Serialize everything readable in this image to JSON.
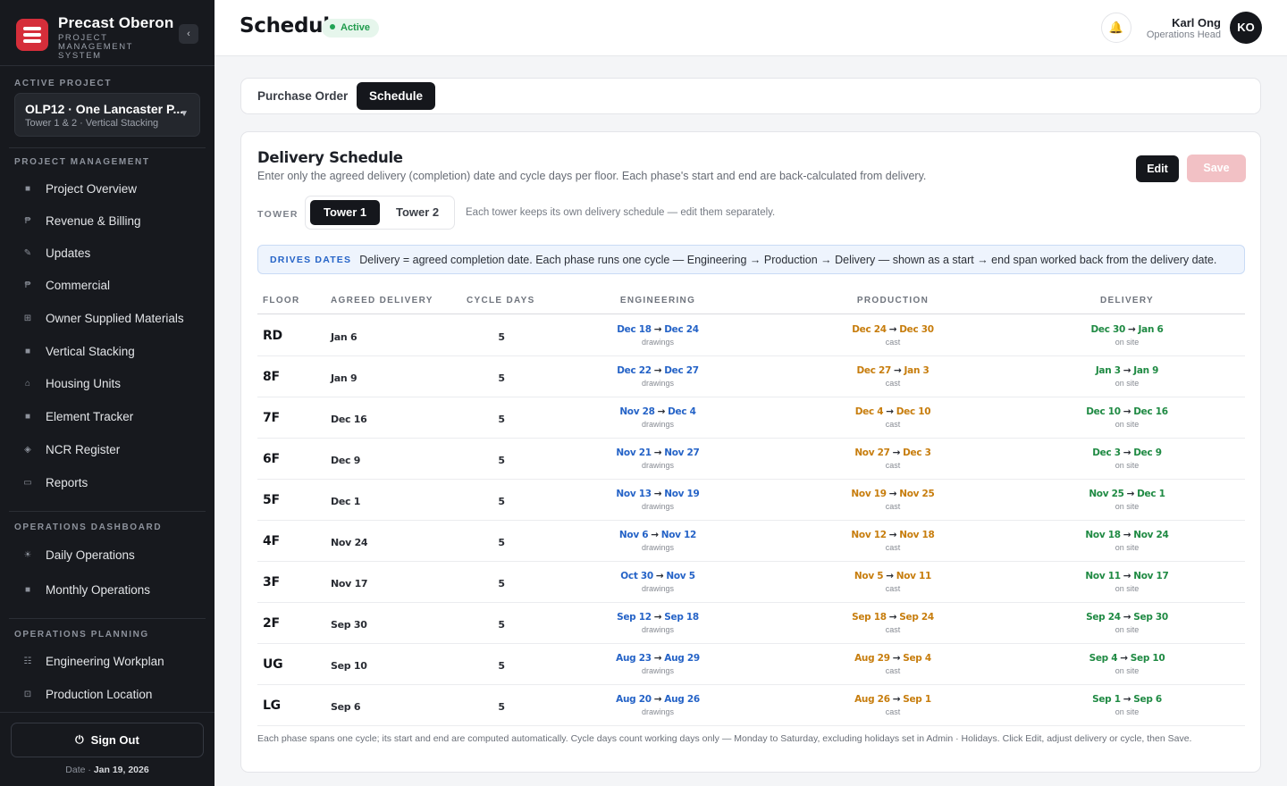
{
  "brand": {
    "name": "Precast Oberon",
    "subtitle": "PROJECT MANAGEMENT SYSTEM"
  },
  "active_project": {
    "label": "ACTIVE PROJECT",
    "name": "OLP12 · One Lancaster P...",
    "subtitle": "Tower 1 & 2 · Vertical Stacking"
  },
  "nav": {
    "project_management": {
      "label": "PROJECT MANAGEMENT",
      "items": [
        {
          "label": "Project Overview",
          "icon": "square-icon",
          "glyph": "■"
        },
        {
          "label": "Revenue & Billing",
          "icon": "peso-icon",
          "glyph": "₱"
        },
        {
          "label": "Updates",
          "icon": "pencil-icon",
          "glyph": "✎"
        },
        {
          "label": "Commercial",
          "icon": "peso-icon",
          "glyph": "₱"
        },
        {
          "label": "Owner Supplied Materials",
          "icon": "grid-icon",
          "glyph": "⊞"
        },
        {
          "label": "Vertical Stacking",
          "icon": "square-icon",
          "glyph": "■"
        },
        {
          "label": "Housing Units",
          "icon": "home-icon",
          "glyph": "⌂"
        },
        {
          "label": "Element Tracker",
          "icon": "square-icon",
          "glyph": "■"
        },
        {
          "label": "NCR Register",
          "icon": "diamond-icon",
          "glyph": "◈"
        },
        {
          "label": "Reports",
          "icon": "reports-icon",
          "glyph": "▭"
        }
      ]
    },
    "operations_dashboard": {
      "label": "OPERATIONS DASHBOARD",
      "items": [
        {
          "label": "Daily Operations",
          "icon": "sun-icon",
          "glyph": "☀"
        },
        {
          "label": "Monthly Operations",
          "icon": "square-icon",
          "glyph": "■"
        }
      ]
    },
    "operations_planning": {
      "label": "OPERATIONS PLANNING",
      "items": [
        {
          "label": "Engineering Workplan",
          "icon": "list-icon",
          "glyph": "☷"
        },
        {
          "label": "Production Location",
          "icon": "location-icon",
          "glyph": "⊡"
        }
      ]
    }
  },
  "signout": {
    "label": "Sign Out",
    "icon": "power-icon"
  },
  "footer_date": {
    "label": "Date ·",
    "value": "Jan 19, 2026"
  },
  "header": {
    "title": "Schedule",
    "status": "Active",
    "user": {
      "name": "Karl Ong",
      "role": "Operations Head",
      "initials": "KO"
    }
  },
  "tabs": [
    {
      "label": "Purchase Order",
      "active": false
    },
    {
      "label": "Schedule",
      "active": true
    }
  ],
  "schedule": {
    "title": "Delivery Schedule",
    "description": "Enter only the agreed delivery (completion) date and cycle days per floor. Each phase's start and end are back-calculated from delivery.",
    "edit_label": "Edit",
    "save_label": "Save",
    "tower_label": "TOWER",
    "towers": [
      {
        "label": "Tower 1",
        "active": true
      },
      {
        "label": "Tower 2",
        "active": false
      }
    ],
    "tower_note": "Each tower keeps its own delivery schedule — edit them separately.",
    "banner": {
      "tag": "DRIVES DATES",
      "text": "Delivery = agreed completion date. Each phase runs one cycle — Engineering → Production → Delivery — shown as a start → end span worked back from the delivery date."
    },
    "columns": [
      "FLOOR",
      "AGREED DELIVERY",
      "CYCLE DAYS",
      "ENGINEERING",
      "PRODUCTION",
      "DELIVERY"
    ],
    "phase_subs": {
      "engineering": "drawings",
      "production": "cast",
      "delivery": "on site"
    },
    "rows": [
      {
        "floor": "RD",
        "agreed": "Jan 6",
        "cycle": "5",
        "eng": [
          "Dec 18",
          "Dec 24"
        ],
        "prod": [
          "Dec 24",
          "Dec 30"
        ],
        "del": [
          "Dec 30",
          "Jan 6"
        ]
      },
      {
        "floor": "8F",
        "agreed": "Jan 9",
        "cycle": "5",
        "eng": [
          "Dec 22",
          "Dec 27"
        ],
        "prod": [
          "Dec 27",
          "Jan 3"
        ],
        "del": [
          "Jan 3",
          "Jan 9"
        ]
      },
      {
        "floor": "7F",
        "agreed": "Dec 16",
        "cycle": "5",
        "eng": [
          "Nov 28",
          "Dec 4"
        ],
        "prod": [
          "Dec 4",
          "Dec 10"
        ],
        "del": [
          "Dec 10",
          "Dec 16"
        ]
      },
      {
        "floor": "6F",
        "agreed": "Dec 9",
        "cycle": "5",
        "eng": [
          "Nov 21",
          "Nov 27"
        ],
        "prod": [
          "Nov 27",
          "Dec 3"
        ],
        "del": [
          "Dec 3",
          "Dec 9"
        ]
      },
      {
        "floor": "5F",
        "agreed": "Dec 1",
        "cycle": "5",
        "eng": [
          "Nov 13",
          "Nov 19"
        ],
        "prod": [
          "Nov 19",
          "Nov 25"
        ],
        "del": [
          "Nov 25",
          "Dec 1"
        ]
      },
      {
        "floor": "4F",
        "agreed": "Nov 24",
        "cycle": "5",
        "eng": [
          "Nov 6",
          "Nov 12"
        ],
        "prod": [
          "Nov 12",
          "Nov 18"
        ],
        "del": [
          "Nov 18",
          "Nov 24"
        ]
      },
      {
        "floor": "3F",
        "agreed": "Nov 17",
        "cycle": "5",
        "eng": [
          "Oct 30",
          "Nov 5"
        ],
        "prod": [
          "Nov 5",
          "Nov 11"
        ],
        "del": [
          "Nov 11",
          "Nov 17"
        ]
      },
      {
        "floor": "2F",
        "agreed": "Sep 30",
        "cycle": "5",
        "eng": [
          "Sep 12",
          "Sep 18"
        ],
        "prod": [
          "Sep 18",
          "Sep 24"
        ],
        "del": [
          "Sep 24",
          "Sep 30"
        ]
      },
      {
        "floor": "UG",
        "agreed": "Sep 10",
        "cycle": "5",
        "eng": [
          "Aug 23",
          "Aug 29"
        ],
        "prod": [
          "Aug 29",
          "Sep 4"
        ],
        "del": [
          "Sep 4",
          "Sep 10"
        ]
      },
      {
        "floor": "LG",
        "agreed": "Sep 6",
        "cycle": "5",
        "eng": [
          "Aug 20",
          "Aug 26"
        ],
        "prod": [
          "Aug 26",
          "Sep 1"
        ],
        "del": [
          "Sep 1",
          "Sep 6"
        ]
      }
    ],
    "footnote": "Each phase spans one cycle; its start and end are computed automatically. Cycle days count working days only — Monday to Saturday, excluding holidays set in Admin · Holidays. Click Edit, adjust delivery or cycle, then Save."
  },
  "colors": {
    "accent": "#d52e3a",
    "engineering": "#2563c7",
    "production": "#c77d0d",
    "delivery": "#1f8a43",
    "active_status": "#1f9b4c"
  }
}
